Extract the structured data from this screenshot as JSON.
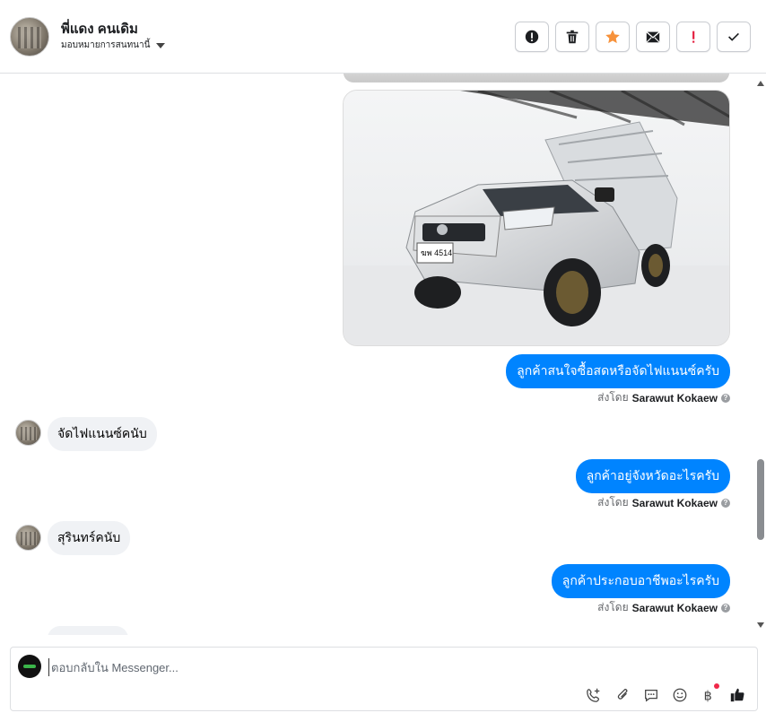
{
  "header": {
    "contact_name": "พี่แดง คนเดิม",
    "assign_label": "มอบหมายการสนทนานี้",
    "actions": [
      {
        "name": "spam-button",
        "icon": "alert-circle-icon"
      },
      {
        "name": "delete-button",
        "icon": "trash-icon"
      },
      {
        "name": "star-button",
        "icon": "star-icon",
        "color": "#f7923b"
      },
      {
        "name": "mark-unread-button",
        "icon": "envelope-icon"
      },
      {
        "name": "follow-up-button",
        "icon": "exclamation-icon",
        "color": "#e41e3f"
      },
      {
        "name": "mark-done-button",
        "icon": "check-icon"
      }
    ]
  },
  "messages": [
    {
      "direction": "outgoing",
      "type": "image",
      "description": "photo"
    },
    {
      "direction": "outgoing",
      "text": "ลูกค้าสนใจซื้อสดหรือจัดไฟแนนซ์ครับ",
      "sent_by_prefix": "ส่งโดย",
      "sender": "Sarawut Kokaew"
    },
    {
      "direction": "incoming",
      "text": "จัดไฟแนนซ์คนับ"
    },
    {
      "direction": "outgoing",
      "text": "ลูกค้าอยู่จังหวัดอะไรครับ",
      "sent_by_prefix": "ส่งโดย",
      "sender": "Sarawut Kokaew"
    },
    {
      "direction": "incoming",
      "text": "สุรินทร์คนับ"
    },
    {
      "direction": "outgoing",
      "text": "ลูกค้าประกอบอาชีพอะไรครับ",
      "sent_by_prefix": "ส่งโดย",
      "sender": "Sarawut Kokaew"
    }
  ],
  "composer": {
    "placeholder": "ตอบกลับใน Messenger...",
    "tools": [
      "phone-add-icon",
      "paperclip-icon",
      "saved-reply-icon",
      "emoji-icon",
      "baht-payment-icon",
      "thumbs-up-icon"
    ]
  },
  "colors": {
    "outgoing_bubble": "#0084ff",
    "incoming_bubble": "#f0f2f5",
    "star": "#f7923b",
    "alert": "#e41e3f"
  }
}
